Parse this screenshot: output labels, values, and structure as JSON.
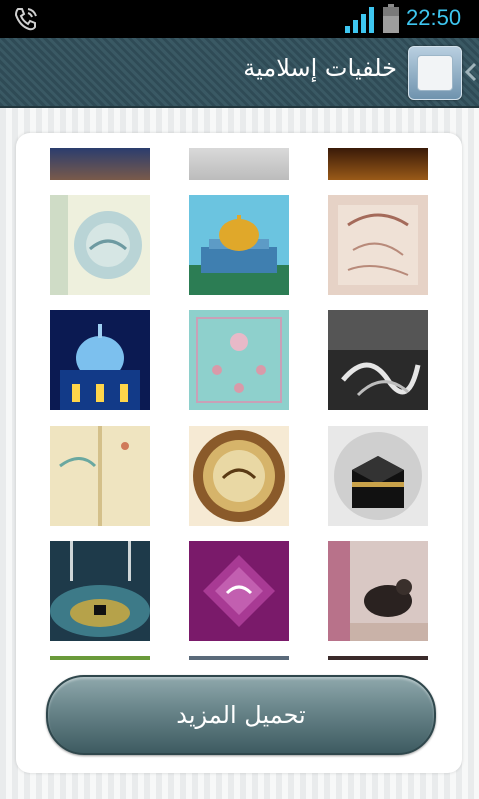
{
  "status_bar": {
    "time": "22:50",
    "icons": [
      "phone-icon",
      "signal-icon",
      "battery-icon"
    ],
    "time_color": "#3ec6f0"
  },
  "header": {
    "title": "خلفيات إسلامية",
    "icon_name": "app-icon",
    "background": "#34525c"
  },
  "gallery": {
    "rows": [
      [
        "mosque-dusk-wallpaper",
        "gray-floral-wallpaper",
        "gold-calligraphy-wallpaper"
      ],
      [
        "green-arabesque-wallpaper",
        "dome-of-the-rock-wallpaper",
        "vintage-calligraphy-wallpaper"
      ],
      [
        "blue-mosque-night-wallpaper",
        "teal-pattern-wallpaper",
        "muhammad-calligraphy-wallpaper"
      ],
      [
        "cream-calligraphy-wallpaper",
        "golden-medallion-wallpaper",
        "kaaba-wallpaper"
      ],
      [
        "mecca-aerial-wallpaper",
        "purple-allah-wallpaper",
        "prayer-wallpaper"
      ],
      [
        "partial-tile-1",
        "partial-tile-2",
        "partial-tile-3"
      ]
    ]
  },
  "load_more": {
    "label": "تحميل المزيد"
  }
}
